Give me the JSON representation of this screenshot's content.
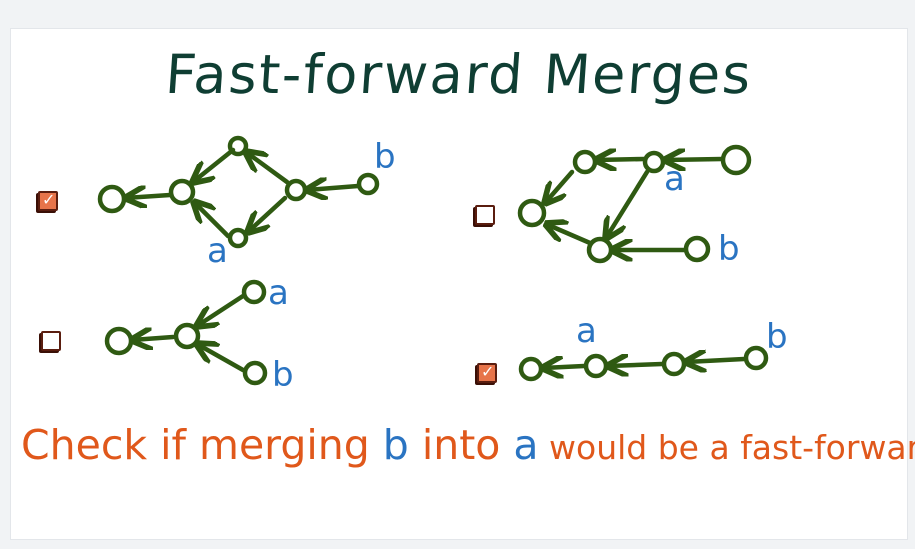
{
  "title": "Fast-forward Merges",
  "colors": {
    "title": "#0f3e33",
    "graph": "#2f5a12",
    "branch_label": "#2a74c2",
    "prompt": "#e0581b",
    "checkbox_checked": "#e7744a"
  },
  "options": [
    {
      "id": "top-left",
      "checked": true,
      "labels": {
        "a": "a",
        "b": "b"
      }
    },
    {
      "id": "top-right",
      "checked": false,
      "labels": {
        "a": "a",
        "b": "b"
      }
    },
    {
      "id": "bottom-left",
      "checked": false,
      "labels": {
        "a": "a",
        "b": "b"
      }
    },
    {
      "id": "bottom-right",
      "checked": true,
      "labels": {
        "a": "a",
        "b": "b"
      }
    }
  ],
  "checkmark": "✓",
  "prompt": {
    "part1": "Check if merging ",
    "b": "b",
    "part2": " into ",
    "a": "a",
    "part3": " would be a fast-forward"
  }
}
